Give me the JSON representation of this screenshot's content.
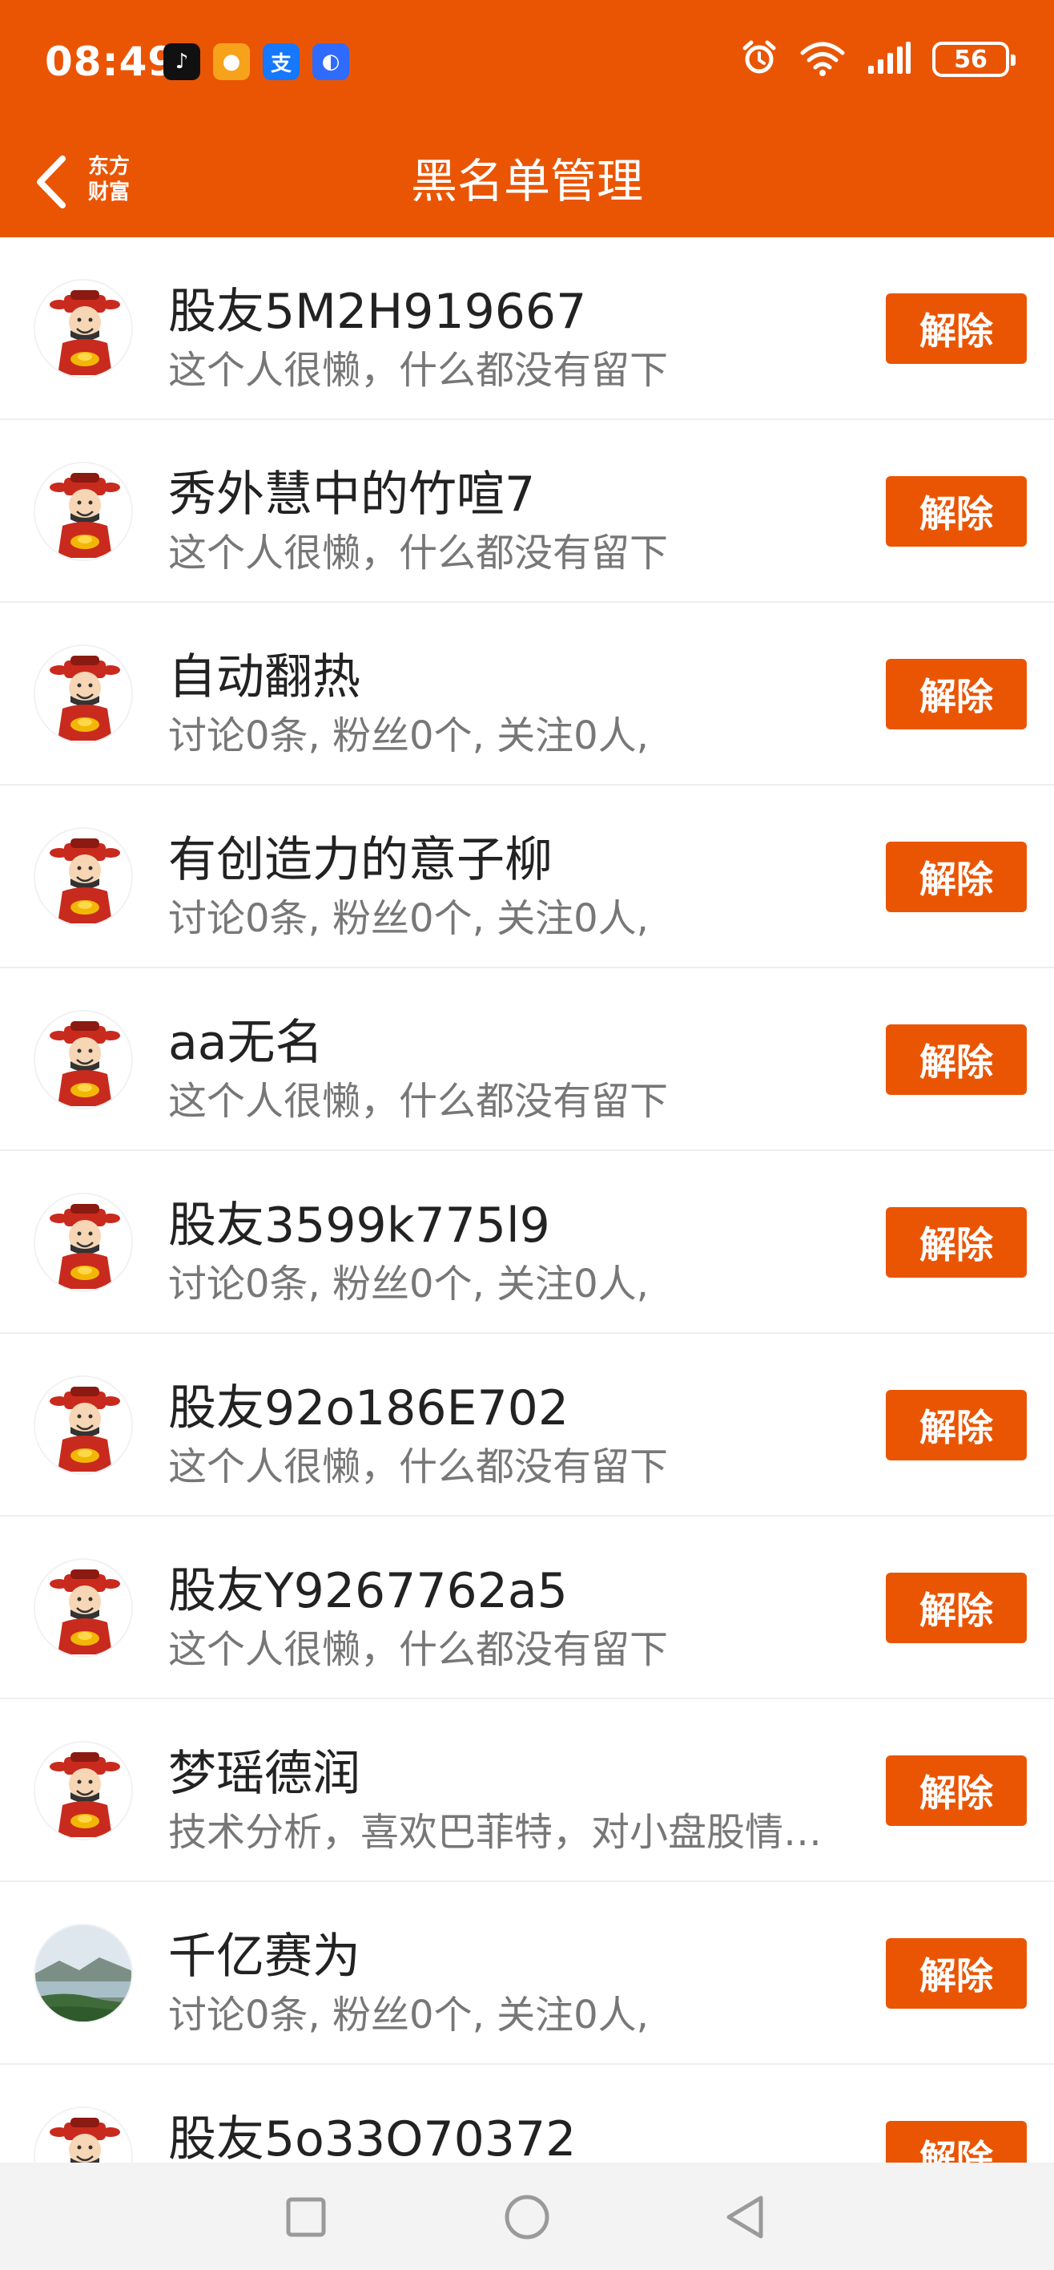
{
  "status_bar": {
    "time": "08:49",
    "battery": "56",
    "notification_apps": [
      {
        "icon": "tiktok-icon",
        "glyph": "♪",
        "bg": "#111111"
      },
      {
        "icon": "app-icon-yellow",
        "glyph": "●",
        "bg": "#F7A21B"
      },
      {
        "icon": "alipay-icon",
        "glyph": "支",
        "bg": "#1677FF"
      },
      {
        "icon": "app-icon-blue",
        "glyph": "◐",
        "bg": "#2F6BFF"
      }
    ]
  },
  "nav": {
    "title": "黑名单管理",
    "brand_line1": "东方",
    "brand_line2": "财富"
  },
  "colors": {
    "accent": "#EA5504"
  },
  "blocklist": {
    "unblock_label": "解除",
    "items": [
      {
        "name": "股友5M2H919667",
        "desc": "这个人很懒，什么都没有留下",
        "avatar": "caishen"
      },
      {
        "name": "秀外慧中的竹喧7",
        "desc": "这个人很懒，什么都没有留下",
        "avatar": "caishen"
      },
      {
        "name": "自动翻热",
        "desc": "讨论0条, 粉丝0个, 关注0人,",
        "avatar": "caishen"
      },
      {
        "name": "有创造力的意子柳",
        "desc": "讨论0条, 粉丝0个, 关注0人,",
        "avatar": "caishen"
      },
      {
        "name": "aa无名",
        "desc": "这个人很懒，什么都没有留下",
        "avatar": "caishen"
      },
      {
        "name": "股友3599k775l9",
        "desc": "讨论0条, 粉丝0个, 关注0人,",
        "avatar": "caishen"
      },
      {
        "name": "股友92o186E702",
        "desc": "这个人很懒，什么都没有留下",
        "avatar": "caishen"
      },
      {
        "name": "股友Y9267762a5",
        "desc": "这个人很懒，什么都没有留下",
        "avatar": "caishen"
      },
      {
        "name": "梦瑶德润",
        "desc": "技术分析，喜欢巴菲特，对小盘股情…",
        "avatar": "caishen"
      },
      {
        "name": "千亿赛为",
        "desc": "讨论0条, 粉丝0个, 关注0人,",
        "avatar": "landscape-photo"
      },
      {
        "name": "股友5o33O70372",
        "desc": "",
        "avatar": "caishen"
      }
    ]
  }
}
